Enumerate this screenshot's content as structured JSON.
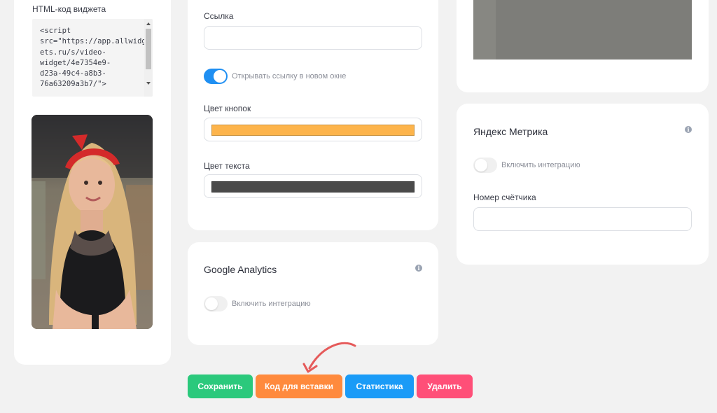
{
  "left_panel": {
    "html_code_label": "HTML-код виджета",
    "html_code": "<script\nsrc=\"https://app.allwidg\nets.ru/s/video-\nwidget/4e7354e9-\nd23a-49c4-a8b3-\n76a63209a3b7/\">"
  },
  "link_card": {
    "link_label": "Ссылка",
    "link_value": "",
    "open_new_window_label": "Открывать ссылку в новом окне",
    "button_color_label": "Цвет кнопок",
    "button_color": "#fdb44b",
    "text_color_label": "Цвет текста",
    "text_color": "#4a4a4a"
  },
  "google_analytics": {
    "title": "Google Analytics",
    "toggle_label": "Включить интеграцию"
  },
  "yandex_metrika": {
    "title": "Яндекс Метрика",
    "toggle_label": "Включить интеграцию",
    "counter_label": "Номер счётчика",
    "counter_value": ""
  },
  "actions": {
    "save": "Сохранить",
    "embed_code": "Код для вставки",
    "statistics": "Статистика",
    "delete": "Удалить"
  },
  "colors": {
    "save": "#2bc97c",
    "embed_code": "#ff8a3d",
    "statistics": "#1a9bf7",
    "delete": "#ff4f78",
    "annotation_arrow": "#e55a5a"
  }
}
